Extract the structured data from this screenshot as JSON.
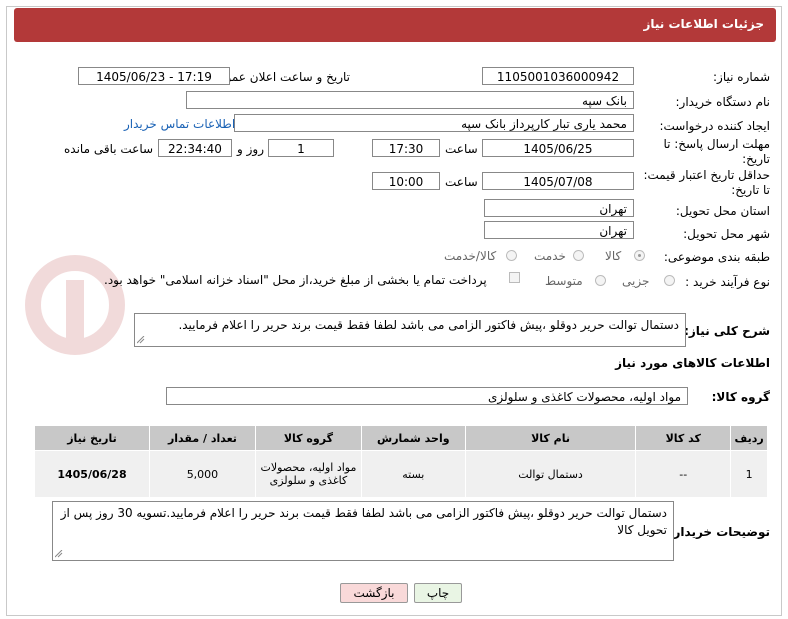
{
  "header": {
    "title": "جزئیات اطلاعات نیاز"
  },
  "fields": {
    "need_number_label": "شماره نیاز:",
    "need_number": "1105001036000942",
    "announce_label": "تاریخ و ساعت اعلان عمومی:",
    "announce_value": "1405/06/23 - 17:19",
    "buyer_org_label": "نام دستگاه خریدار:",
    "buyer_org": "بانک سپه",
    "creator_label": "ایجاد کننده درخواست:",
    "creator": "محمد یاری تبار کارپرداز بانک سپه",
    "contact_link": "اطلاعات تماس خریدار",
    "deadline_label_1": "مهلت ارسال پاسخ: تا",
    "deadline_label_2": "تاریخ:",
    "deadline_date": "1405/06/25",
    "time_label": "ساعت",
    "deadline_time": "17:30",
    "days_value": "1",
    "days_label": "روز و",
    "remaining_value": "22:34:40",
    "remaining_label": "ساعت باقی مانده",
    "validity_label_1": "حداقل تاریخ اعتبار قیمت:",
    "validity_label_2": "تا تاریخ:",
    "validity_date": "1405/07/08",
    "validity_time_label": "ساعت",
    "validity_time": "10:00",
    "province_label": "استان محل تحویل:",
    "province": "تهران",
    "city_label": "شهر محل تحویل:",
    "city": "تهران",
    "category_label": "طبقه بندی موضوعی:",
    "category_options": [
      "کالا",
      "خدمت",
      "کالا/خدمت"
    ],
    "process_label": "نوع فرآیند خرید :",
    "process_options": [
      "جزیی",
      "متوسط"
    ],
    "treasury_note": "پرداخت تمام یا بخشی از مبلغ خرید،از محل \"اسناد خزانه اسلامی\" خواهد بود."
  },
  "description": {
    "label": "شرح کلی نیاز:",
    "text": "دستمال توالت حریر دوقلو ،پیش فاکتور الزامی می باشد لطفا فقط قیمت برند حریر را اعلام فرمایید."
  },
  "goods_section": {
    "title": "اطلاعات کالاهای مورد نیاز",
    "group_label": "گروه کالا:",
    "group_value": "مواد اولیه، محصولات کاغذی و سلولزی"
  },
  "table": {
    "headers": [
      "ردیف",
      "کد کالا",
      "نام کالا",
      "واحد شمارش",
      "گروه کالا",
      "تعداد / مقدار",
      "تاریخ نیاز"
    ],
    "rows": [
      [
        "1",
        "--",
        "دستمال توالت",
        "بسته",
        "مواد اولیه، محصولات کاغذی و سلولزی",
        "5,000",
        "1405/06/28"
      ]
    ]
  },
  "buyer_notes": {
    "label": "توضیحات خریدار:",
    "text": "دستمال توالت حریر دوقلو ،پیش فاکتور الزامی می باشد لطفا فقط قیمت برند حریر را اعلام فرمایید.تسویه 30 روز پس از تحویل کالا"
  },
  "buttons": {
    "print": "چاپ",
    "back": "بازگشت"
  },
  "colors": {
    "header_bg": "#b33939",
    "link": "#1a62b5",
    "back_btn_bg": "#f9d9d9",
    "print_btn_bg": "#e9f5e4"
  }
}
